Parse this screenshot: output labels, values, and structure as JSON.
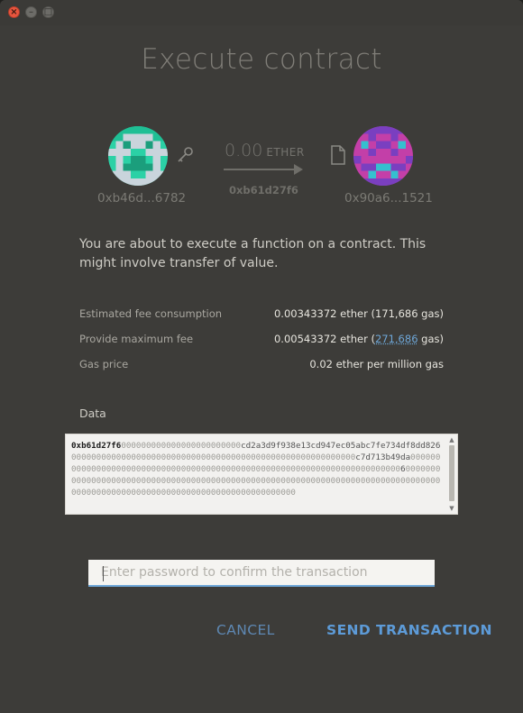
{
  "window": {
    "title": "Execute contract",
    "controls": {
      "close": "×",
      "minimize": "–",
      "maximize": "□"
    }
  },
  "transfer": {
    "from_address": "0xb46d...6782",
    "to_address": "0x90a6...1521",
    "amount": "0.00",
    "unit": "ETHER",
    "method_id": "0xb61d27f6",
    "icons": {
      "from": "key-icon",
      "to": "file-icon",
      "arrow": "arrow-right-icon"
    }
  },
  "description": "You are about to execute a function on a contract. This might involve transfer of value.",
  "fees": {
    "estimated_label": "Estimated fee consumption",
    "estimated_value": "0.00343372 ether (171,686 gas)",
    "max_label": "Provide maximum fee",
    "max_value_prefix": "0.00543372 ether (",
    "max_gas": "271,686",
    "max_value_suffix": " gas)",
    "gas_price_label": "Gas price",
    "gas_price_value": "0.02 ether per million gas"
  },
  "data": {
    "label": "Data",
    "method": "0xb61d27f6",
    "z1": "000000000000000000000000",
    "d1": "cd2a3d9f938e13cd947ec05abc7fe734df8dd826",
    "z2": "000000000000000000000000000000000000000000000000000000000",
    "d2": "c7d713b49da",
    "z3": "000000000000000000000000000000000000000000000000000000000000000000000000",
    "d3": "6",
    "z4": "000000000000000000000000000000000000000000000000000000000000000000000000000000000000000000000000000000000000000000000000000000"
  },
  "password": {
    "placeholder": "Enter password to confirm the transaction",
    "value": ""
  },
  "buttons": {
    "cancel": "CANCEL",
    "send": "SEND TRANSACTION"
  },
  "colors": {
    "background": "#3d3c39",
    "accent": "#5d9bd8",
    "from_identicon": [
      "#2bd1a6",
      "#c9d4dc",
      "#1b9e7c"
    ],
    "to_identicon": [
      "#c33fa8",
      "#7a3fc0",
      "#35c0cf"
    ]
  }
}
